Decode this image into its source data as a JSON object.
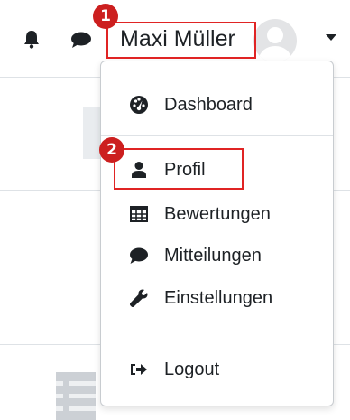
{
  "header": {
    "user_name": "Maxi Müller",
    "notifications_icon": "bell-icon",
    "messages_icon": "chat-bubble-icon",
    "avatar_icon": "user-avatar",
    "menu_toggle_icon": "caret-down-icon"
  },
  "annotations": {
    "step_1": "1",
    "step_2": "2",
    "highlight_color": "#e02424",
    "badge_color": "#cc1f1f"
  },
  "user_menu": {
    "items": [
      {
        "label": "Dashboard",
        "icon": "tachometer-icon"
      },
      {
        "label": "Profil",
        "icon": "user-icon"
      },
      {
        "label": "Bewertungen",
        "icon": "table-icon"
      },
      {
        "label": "Mitteilungen",
        "icon": "comment-icon"
      },
      {
        "label": "Einstellungen",
        "icon": "wrench-icon"
      },
      {
        "label": "Logout",
        "icon": "sign-out-icon"
      }
    ]
  }
}
